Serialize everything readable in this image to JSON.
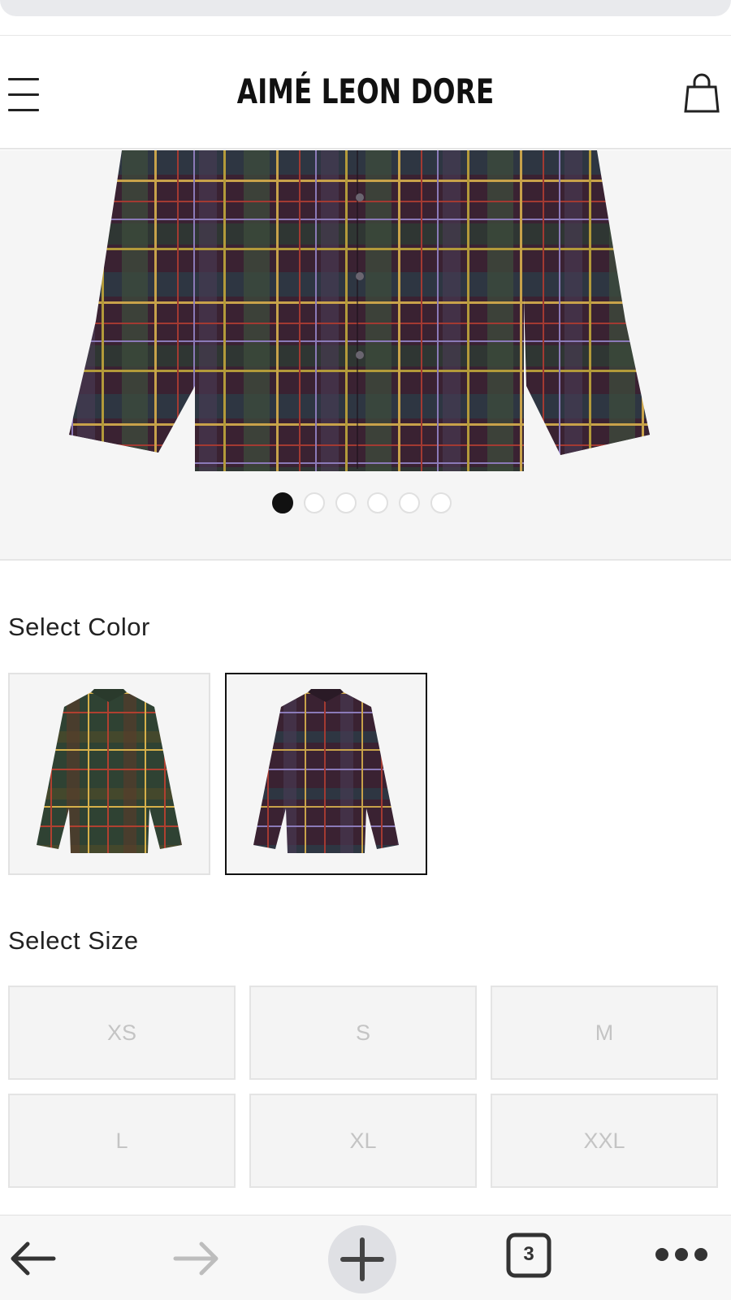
{
  "header": {
    "brand": "AIMÉ LEON DORE",
    "menu_icon": "hamburger-menu-icon",
    "cart_icon": "shopping-bag-icon"
  },
  "gallery": {
    "slides": 6,
    "active_slide": 1
  },
  "colors": {
    "title": "Select Color",
    "options": [
      {
        "name": "green plaid",
        "selected": false,
        "main": "#2f3e2c"
      },
      {
        "name": "purple plaid",
        "selected": true,
        "main": "#3a2433"
      }
    ]
  },
  "sizes": {
    "title": "Select Size",
    "options": [
      "XS",
      "S",
      "M",
      "L",
      "XL",
      "XXL"
    ]
  },
  "browser_toolbar": {
    "tab_count": "3",
    "icons": [
      "back-arrow-icon",
      "forward-arrow-icon",
      "new-tab-plus-icon",
      "tabs-icon",
      "more-icon"
    ]
  }
}
